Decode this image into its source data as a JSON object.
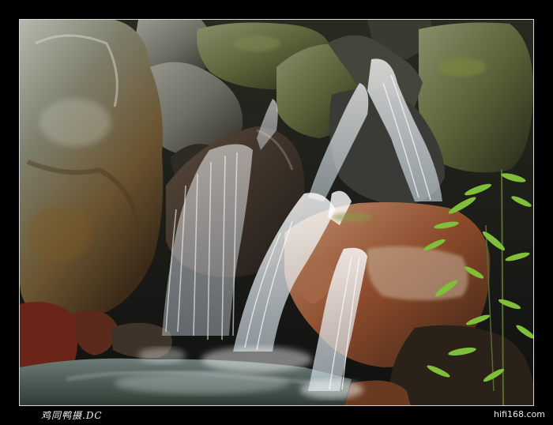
{
  "photo": {
    "subject": "waterfall-over-boulders",
    "palette": {
      "shadow": "#171712",
      "rock_grey": "#6d6d63",
      "rock_moss": "#5a6238",
      "rock_rust": "#8a4a2a",
      "water": "#dfe8ef",
      "pool": "#4a5a4e",
      "leaf": "#7fbf3a"
    }
  },
  "footer": {
    "signature": "鸡同鸭摄.DC",
    "site": "hifi168.com"
  }
}
